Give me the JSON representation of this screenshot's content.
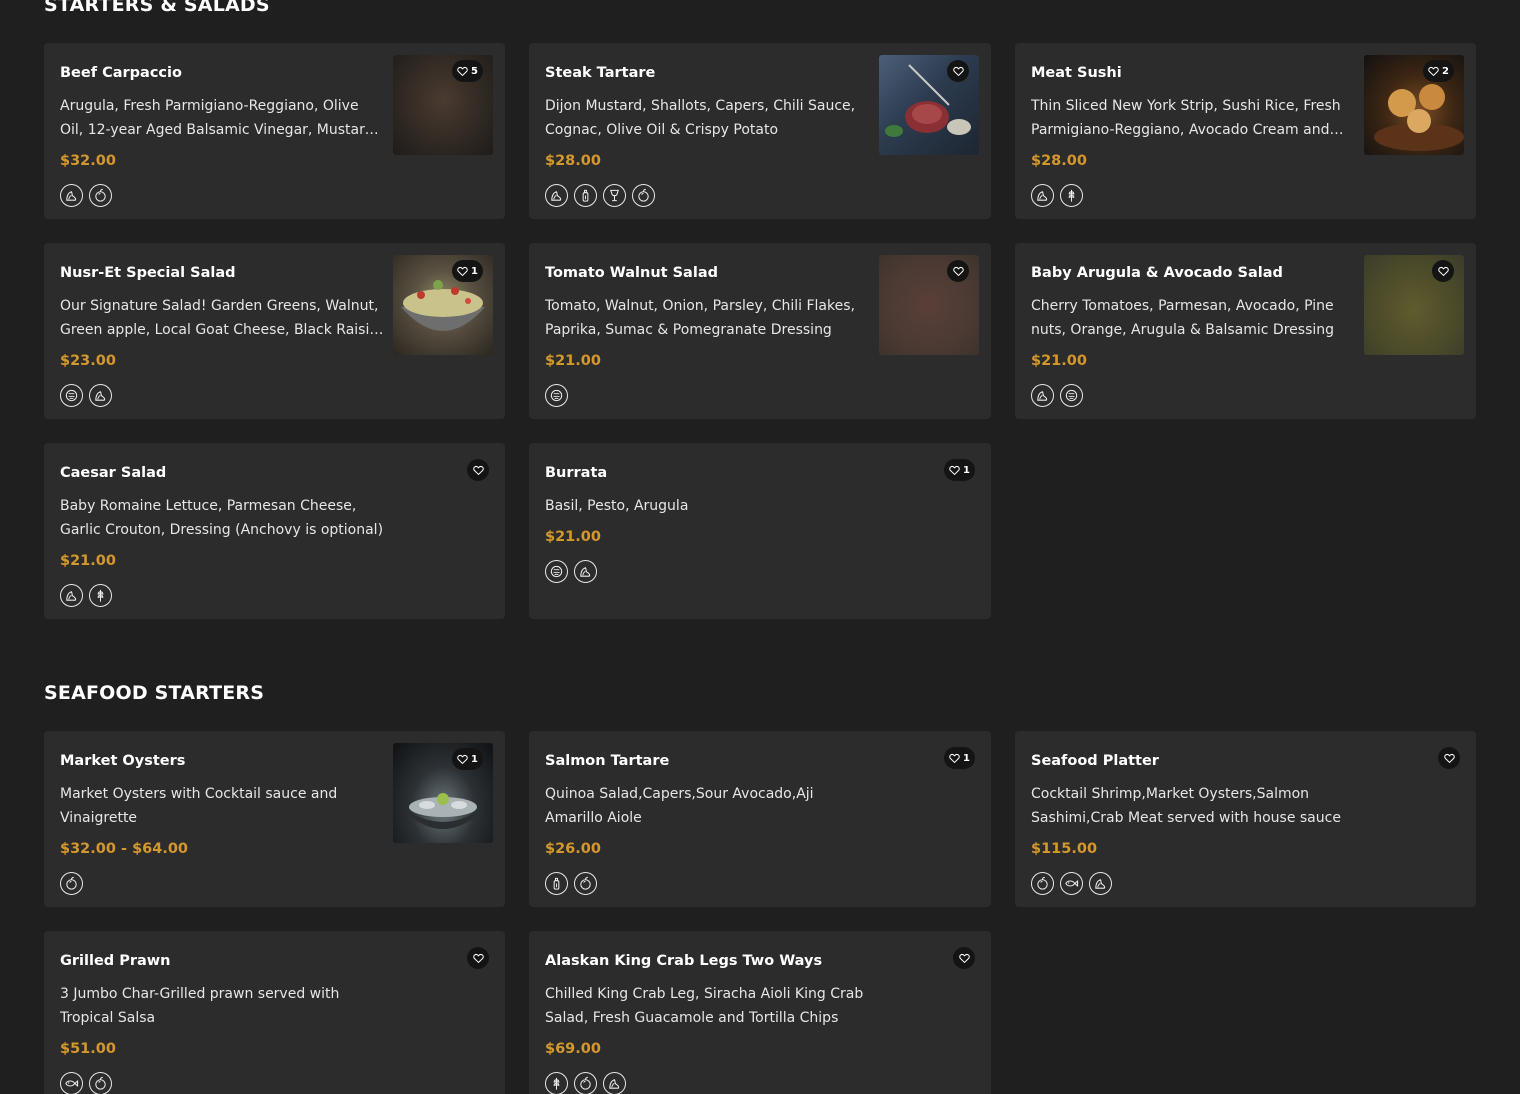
{
  "sections": [
    {
      "title": "STARTERS & SALADS",
      "items": [
        {
          "name": "Beef Carpaccio",
          "desc": "Arugula, Fresh Parmigiano-Reggiano, Olive Oil, 12-year Aged Balsamic Vinegar, Mustard, Salt & Pepper",
          "price": "$32.00",
          "likes": "5"
        },
        {
          "name": "Steak Tartare",
          "desc": "Dijon Mustard, Shallots, Capers, Chili Sauce, Cognac, Olive Oil & Crispy Potato",
          "price": "$28.00",
          "likes": ""
        },
        {
          "name": "Meat Sushi",
          "desc": "Thin Sliced New York Strip, Sushi Rice, Fresh Parmigiano-Reggiano, Avocado Cream and Truffle",
          "price": "$28.00",
          "likes": "2"
        },
        {
          "name": "Nusr-Et Special Salad",
          "desc": "Our Signature Salad! Garden Greens, Walnut, Green apple, Local Goat Cheese, Black Raisin, Pomegranate",
          "price": "$23.00",
          "likes": "1"
        },
        {
          "name": "Tomato Walnut Salad",
          "desc": "Tomato, Walnut, Onion, Parsley, Chili Flakes, Paprika, Sumac & Pomegranate Dressing",
          "price": "$21.00",
          "likes": ""
        },
        {
          "name": "Baby Arugula & Avocado Salad",
          "desc": "Cherry Tomatoes, Parmesan, Avocado, Pine nuts, Orange, Arugula & Balsamic Dressing",
          "price": "$21.00",
          "likes": ""
        },
        {
          "name": "Caesar Salad",
          "desc": "Baby Romaine Lettuce, Parmesan Cheese, Garlic Crouton, Dressing (Anchovy is optional)",
          "price": "$21.00",
          "likes": ""
        },
        {
          "name": "Burrata",
          "desc": "Basil, Pesto, Arugula",
          "price": "$21.00",
          "likes": "1"
        }
      ]
    },
    {
      "title": "SEAFOOD STARTERS",
      "items": [
        {
          "name": "Market Oysters",
          "desc": "Market Oysters with Cocktail sauce and Vinaigrette",
          "price": "$32.00 - $64.00",
          "likes": "1"
        },
        {
          "name": "Salmon Tartare",
          "desc": "Quinoa Salad,Capers,Sour Avocado,Aji Amarillo Aiole",
          "price": "$26.00",
          "likes": "1"
        },
        {
          "name": "Seafood Platter",
          "desc": "Cocktail Shrimp,Market Oysters,Salmon Sashimi,Crab Meat served with house sauce",
          "price": "$115.00",
          "likes": ""
        },
        {
          "name": "Grilled Prawn",
          "desc": "3 Jumbo Char-Grilled prawn served with Tropical Salsa",
          "price": "$51.00",
          "likes": ""
        },
        {
          "name": "Alaskan King Crab Legs Two Ways",
          "desc": "Chilled King Crab Leg, Siracha Aioli King Crab Salad, Fresh Guacamole and Tortilla Chips",
          "price": "$69.00",
          "likes": ""
        }
      ]
    }
  ],
  "icons": {
    "beef_carpaccio": [
      "dairy-icon",
      "mustard-icon"
    ],
    "steak_tartare": [
      "dairy-icon",
      "celery-icon",
      "alcohol-icon",
      "mustard-icon"
    ],
    "meat_sushi": [
      "dairy-icon",
      "gluten-icon"
    ],
    "nusret_salad": [
      "nuts-icon",
      "dairy-icon"
    ],
    "tomato_walnut": [
      "nuts-icon"
    ],
    "arugula_avocado": [
      "dairy-icon",
      "nuts-icon"
    ],
    "caesar": [
      "dairy-icon",
      "gluten-icon"
    ],
    "burrata": [
      "nuts-icon",
      "dairy-icon"
    ],
    "oysters": [
      "mustard-icon"
    ],
    "salmon_tartare": [
      "celery-icon",
      "mustard-icon"
    ],
    "seafood_platter": [
      "mustard-icon",
      "fish-icon",
      "dairy-icon"
    ],
    "grilled_prawn": [
      "fish-icon",
      "mustard-icon"
    ],
    "king_crab": [
      "gluten-icon",
      "mustard-icon",
      "dairy-icon"
    ]
  },
  "colors": {
    "background": "#1f1f1f",
    "card": "#2c2c2c",
    "price": "#d4982d"
  }
}
